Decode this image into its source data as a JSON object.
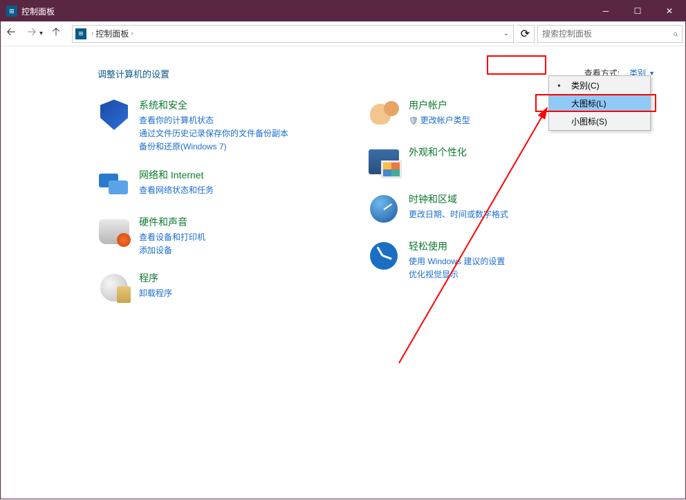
{
  "titlebar": {
    "title": "控制面板"
  },
  "navbar": {
    "breadcrumb": "控制面板",
    "search_placeholder": "搜索控制面板"
  },
  "content": {
    "heading": "调整计算机的设置",
    "view_label": "查看方式:",
    "view_value": "类别"
  },
  "dropdown": {
    "items": [
      {
        "label": "类别(C)",
        "selected": true,
        "hover": false
      },
      {
        "label": "大图标(L)",
        "selected": false,
        "hover": true
      },
      {
        "label": "小图标(S)",
        "selected": false,
        "hover": false
      }
    ]
  },
  "categories_left": [
    {
      "title": "系统和安全",
      "links": [
        "查看你的计算机状态",
        "通过文件历史记录保存你的文件备份副本",
        "备份和还原(Windows 7)"
      ],
      "icon": "security"
    },
    {
      "title": "网络和 Internet",
      "links": [
        "查看网络状态和任务"
      ],
      "icon": "network"
    },
    {
      "title": "硬件和声音",
      "links": [
        "查看设备和打印机",
        "添加设备"
      ],
      "icon": "hardware"
    },
    {
      "title": "程序",
      "links": [
        "卸载程序"
      ],
      "icon": "programs"
    }
  ],
  "categories_right": [
    {
      "title": "用户帐户",
      "links": [
        "更改帐户类型"
      ],
      "link_shield": [
        true
      ],
      "icon": "users"
    },
    {
      "title": "外观和个性化",
      "links": [],
      "icon": "appearance"
    },
    {
      "title": "时钟和区域",
      "links": [
        "更改日期、时间或数字格式"
      ],
      "icon": "clock"
    },
    {
      "title": "轻松使用",
      "links": [
        "使用 Windows 建议的设置",
        "优化视觉显示"
      ],
      "icon": "ease"
    }
  ]
}
